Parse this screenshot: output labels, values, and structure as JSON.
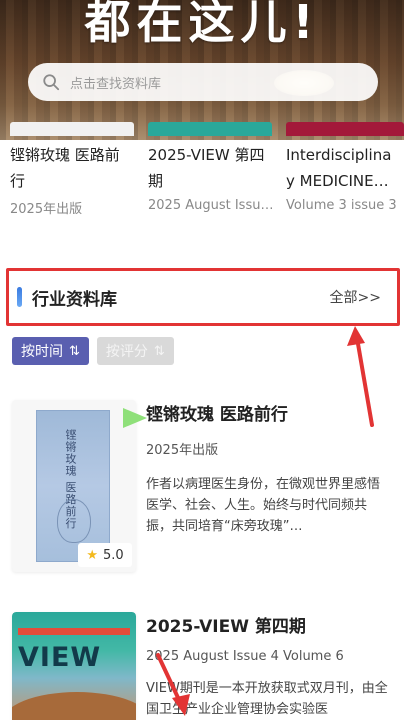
{
  "hero": {
    "title": "都在这儿!",
    "search_placeholder": "点击查找资料库"
  },
  "top_cards": [
    {
      "title": "铿锵玫瑰 医路前行",
      "subtitle": "2025年出版",
      "edge_color": "#2aa89a"
    },
    {
      "title": "2025-VIEW 第四期",
      "subtitle": "2025 August Issu…",
      "edge_color": "#2aa89a"
    },
    {
      "title": "Interdisciplina y MEDICINE…",
      "subtitle": "Volume 3 issue 3",
      "edge_color": "#a3193a"
    }
  ],
  "section": {
    "title": "行业资料库",
    "more": "全部>>"
  },
  "sort": {
    "by_time": "按时间",
    "by_time_arrows": "⇅",
    "by_rating": "按评分",
    "by_rating_arrows": "⇅"
  },
  "books": [
    {
      "title": "铿锵玫瑰 医路前行",
      "subtitle": "2025年出版",
      "description": "作者以病理医生身份，在微观世界里感悟医学、社会、人生。始终与时代同频共振，共同培育“床旁玫瑰”…",
      "cover_text": "铿锵玫瑰 医路前行",
      "rating": "5.0"
    },
    {
      "title": "2025-VIEW 第四期",
      "subtitle": "2025 August Issue 4 Volume 6",
      "description": "VIEW期刊是一本开放获取式双月刊，由全国卫生产业企业管理协会实验医",
      "cover_logo": "VIEW"
    }
  ],
  "colors": {
    "accent_blue": "#3a7be0",
    "active_sort": "#5a5fb0",
    "highlight_red": "#e23434"
  }
}
